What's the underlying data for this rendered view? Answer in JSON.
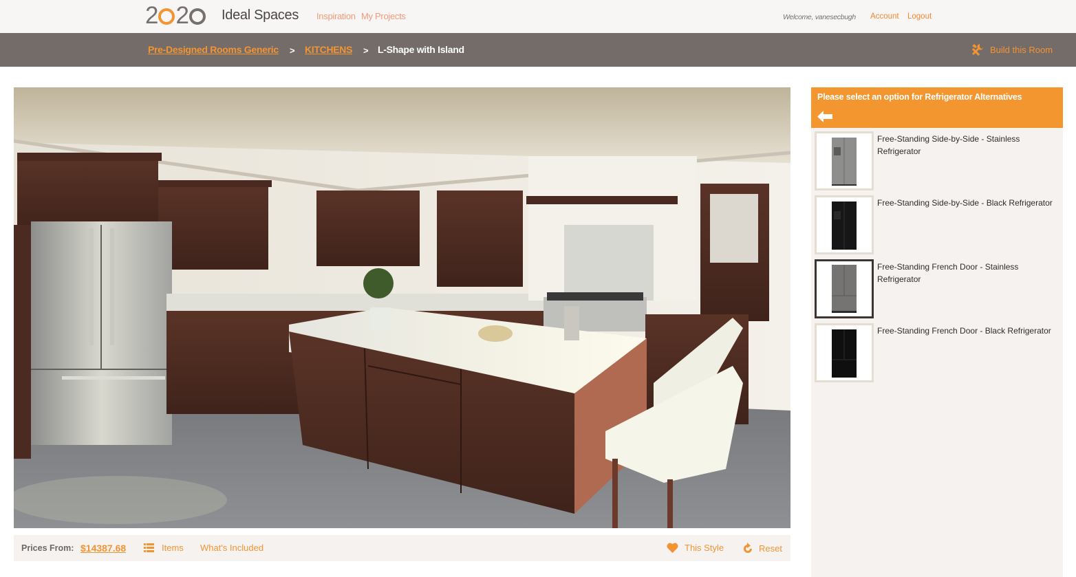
{
  "header": {
    "logo": {
      "digits": [
        "2",
        "0",
        "2",
        "0"
      ]
    },
    "brand": "Ideal Spaces",
    "nav": [
      {
        "label": "Inspiration"
      },
      {
        "label": "My Projects"
      }
    ],
    "welcome": "Welcome, vanesecbugh",
    "account_label": "Account",
    "logout_label": "Logout"
  },
  "breadcrumb": {
    "items": [
      {
        "label": "Pre-Designed Rooms Generic",
        "link": true
      },
      {
        "label": "KITCHENS",
        "link": true
      },
      {
        "label": "L-Shape with Island",
        "link": false
      }
    ],
    "separator": ">",
    "build_label": "Build this Room"
  },
  "render": {
    "alt": "L-Shape kitchen with island rendering",
    "scene": "kitchen-render"
  },
  "price_bar": {
    "price_label": "Prices From:",
    "price_value": "$14387.68",
    "items_label": "Items",
    "included_label": "What's Included",
    "style_label": "This Style",
    "reset_label": "Reset"
  },
  "side_panel": {
    "title": "Please select an option for Refrigerator Alternatives",
    "options": [
      {
        "name": "Free-Standing Side-by-Side - Stainless Refrigerator",
        "type": "side-by-side",
        "finish": "stainless",
        "selected": false
      },
      {
        "name": "Free-Standing Side-by-Side - Black Refrigerator",
        "type": "side-by-side",
        "finish": "black",
        "selected": false
      },
      {
        "name": "Free-Standing French Door - Stainless Refrigerator",
        "type": "french-door",
        "finish": "stainless",
        "selected": true
      },
      {
        "name": "Free-Standing French Door - Black Refrigerator",
        "type": "french-door",
        "finish": "black",
        "selected": false
      }
    ]
  },
  "colors": {
    "accent": "#f39433",
    "header_bar": "#746c69",
    "panel_bg": "#f6f2f0"
  }
}
